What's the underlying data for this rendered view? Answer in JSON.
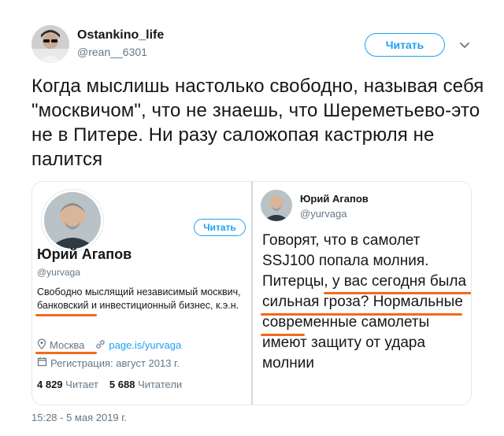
{
  "tweet": {
    "author_name": "Ostankino_life",
    "author_handle": "@rean__6301",
    "follow_label": "Читать",
    "text": "Когда мыслишь настолько свободно, называя себя \"москвичом\", что не знаешь, что Шереметьево-это не в Питере. Ни разу саложопая кастрюля не палится",
    "timestamp": "15:28 - 5 мая 2019 г."
  },
  "profile_card": {
    "name": "Юрий Агапов",
    "handle": "@yurvaga",
    "follow_label": "Читать",
    "bio": "Свободно мыслящий независимый москвич, банковский и инвестиционный бизнес, к.э.н.",
    "location": "Москва",
    "link": "page.is/yurvaga",
    "registered": "Регистрация: август 2013 г.",
    "following_count": "4 829",
    "following_label": "Читает",
    "followers_count": "5 688",
    "followers_label": "Читатели"
  },
  "quoted_tweet": {
    "name": "Юрий Агапов",
    "handle": "@yurvaga",
    "text": "Говорят, что в самолет SSJ100 попала молния. Питерцы, у вас сегодня была сильная гроза? Нормальные современные самолеты имеют защиту от удара молнии"
  },
  "icons": {
    "more": "chevron-down-icon",
    "location": "location-pin-icon",
    "link": "link-icon",
    "calendar": "calendar-icon"
  },
  "colors": {
    "accent": "#1da1f2",
    "highlight_underline": "#f26a1b",
    "muted": "#657786"
  }
}
